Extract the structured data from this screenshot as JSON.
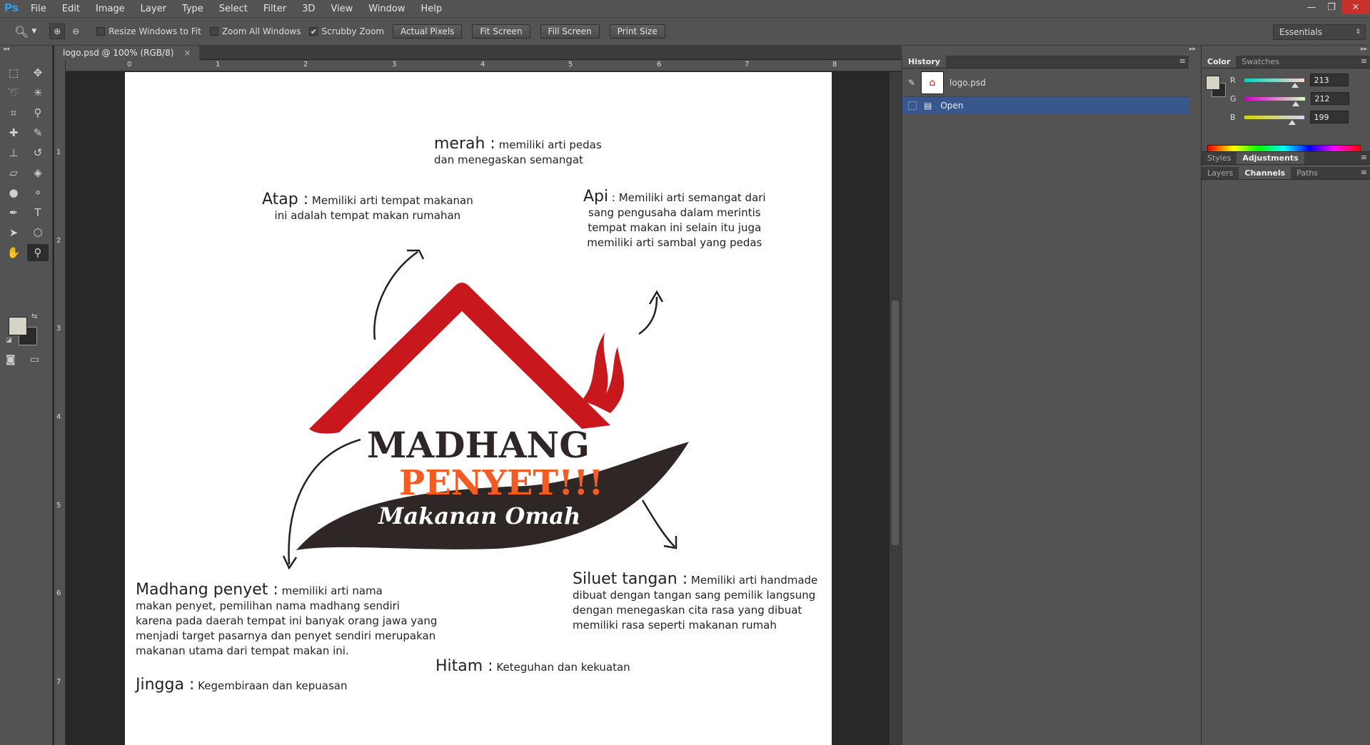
{
  "app": {
    "logo": "Ps"
  },
  "menu": [
    "File",
    "Edit",
    "Image",
    "Layer",
    "Type",
    "Select",
    "Filter",
    "3D",
    "View",
    "Window",
    "Help"
  ],
  "window_controls": {
    "minimize": "—",
    "restore": "❐",
    "close": "✕"
  },
  "options_bar": {
    "resize_windows": "Resize Windows to Fit",
    "zoom_all": "Zoom All Windows",
    "scrubby": "Scrubby Zoom",
    "scrubby_checked": "✔",
    "actual_pixels": "Actual Pixels",
    "fit_screen": "Fit Screen",
    "fill_screen": "Fill Screen",
    "print_size": "Print Size",
    "workspace": "Essentials"
  },
  "document": {
    "tab_title": "logo.psd @ 100% (RGB/8)",
    "close": "×"
  },
  "rulers": {
    "h": [
      "0",
      "1",
      "2",
      "3",
      "4",
      "5",
      "6",
      "7",
      "8"
    ],
    "v": [
      "1",
      "2",
      "3",
      "4",
      "5",
      "6",
      "7"
    ]
  },
  "canvas": {
    "merah_title": "merah :",
    "merah_text1": "memiliki arti pedas",
    "merah_text2": "dan menegaskan semangat",
    "atap_title": "Atap :",
    "atap_text1": "Memiliki arti tempat makanan",
    "atap_text2": "ini adalah tempat makan rumahan",
    "api_title": "Api",
    "api_text1": ": Memiliki arti semangat dari",
    "api_text2": "sang pengusaha dalam merintis",
    "api_text3": "tempat makan ini selain itu juga",
    "api_text4": "memiliki arti sambal yang pedas",
    "logo_madhang": "MADHANG",
    "logo_penyet": "PENYET!!!",
    "logo_makanan": "Makanan Omah",
    "madhang_title": "Madhang penyet :",
    "madhang_text1": "memiliki arti nama",
    "madhang_text2": "makan penyet, pemilihan nama madhang sendiri",
    "madhang_text3": "karena pada daerah tempat ini banyak orang jawa yang",
    "madhang_text4": "menjadi target pasarnya dan penyet sendiri merupakan",
    "madhang_text5": "makanan utama dari tempat makan ini.",
    "siluet_title": "Siluet tangan :",
    "siluet_text1": "Memiliki arti handmade",
    "siluet_text2": "dibuat dengan tangan sang pemilik langsung",
    "siluet_text3": "dengan menegaskan cita rasa yang dibuat",
    "siluet_text4": "memiliki rasa seperti makanan rumah",
    "hitam_title": "Hitam :",
    "hitam_text": "Keteguhan dan kekuatan",
    "jingga_title": "Jingga :",
    "jingga_text": "Kegembiraan dan kepuasan"
  },
  "history_panel": {
    "tab": "History",
    "snapshot": "logo.psd",
    "step": "Open"
  },
  "color_panel": {
    "tabs": [
      "Color",
      "Swatches"
    ],
    "r_label": "R",
    "r_value": "213",
    "g_label": "G",
    "g_value": "212",
    "b_label": "B",
    "b_value": "199",
    "fg_color": "#d5d4c7"
  },
  "styles_tabs": [
    "Styles",
    "Adjustments"
  ],
  "layers_tabs": [
    "Layers",
    "Channels",
    "Paths"
  ],
  "colors": {
    "logo_red": "#c8181e",
    "logo_orange": "#f25c22",
    "logo_dark": "#2f2726",
    "highlight": "#38578d"
  }
}
